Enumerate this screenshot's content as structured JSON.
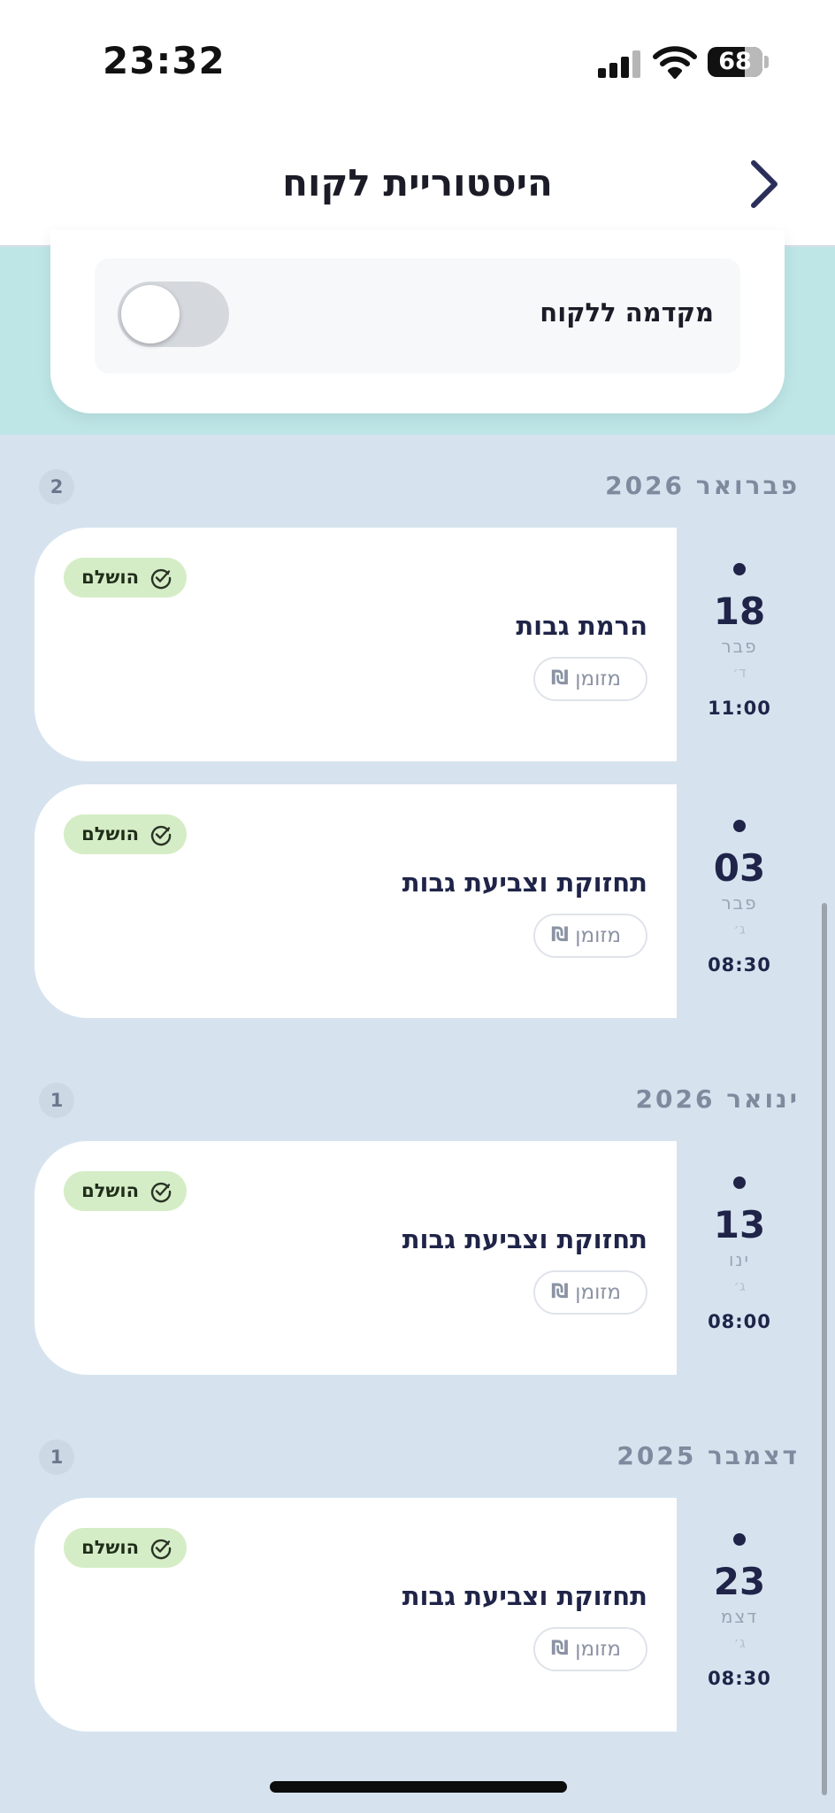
{
  "status_bar": {
    "time": "23:32",
    "battery": "68"
  },
  "header": {
    "title": "היסטוריית לקוח",
    "back_icon": "chevron-right-icon"
  },
  "preference": {
    "label": "מקדמה ללקוח",
    "toggle_on": false
  },
  "groups": [
    {
      "month": "פברואר 2026",
      "count": "2",
      "appointments": [
        {
          "day": "18",
          "month_short": "פבר",
          "weekday": "ד׳",
          "time": "11:00",
          "service": "הרמת גבות",
          "status": "הושלם",
          "booking": "מזומן"
        },
        {
          "day": "03",
          "month_short": "פבר",
          "weekday": "ג׳",
          "time": "08:30",
          "service": "תחזוקת וצביעת גבות",
          "status": "הושלם",
          "booking": "מזומן"
        }
      ]
    },
    {
      "month": "ינואר 2026",
      "count": "1",
      "appointments": [
        {
          "day": "13",
          "month_short": "ינו",
          "weekday": "ג׳",
          "time": "08:00",
          "service": "תחזוקת וצביעת גבות",
          "status": "הושלם",
          "booking": "מזומן"
        }
      ]
    },
    {
      "month": "דצמבר 2025",
      "count": "1",
      "appointments": [
        {
          "day": "23",
          "month_short": "דצמ",
          "weekday": "ג׳",
          "time": "08:30",
          "service": "תחזוקת וצביעת גבות",
          "status": "הושלם",
          "booking": "מזומן"
        }
      ]
    }
  ],
  "icons": {
    "status": "check-circle-icon",
    "payment": "shekel-icon"
  },
  "colors": {
    "primary": "#1f2448",
    "status_bg": "#d5edc6",
    "list_bg": "#d6e3ef",
    "teal": "#bfe6e6"
  }
}
